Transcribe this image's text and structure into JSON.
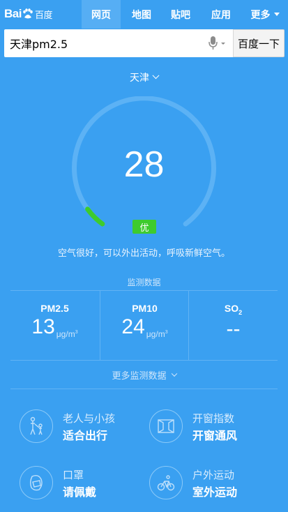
{
  "logo": {
    "text_a": "Bai",
    "text_b": "du",
    "text_cn": "百度"
  },
  "nav": {
    "tabs": [
      "网页",
      "地图",
      "贴吧",
      "应用"
    ],
    "more": "更多",
    "active_index": 0
  },
  "search": {
    "value": "天津pm2.5",
    "button": "百度一下"
  },
  "city": "天津",
  "aqi": {
    "value": "28",
    "level": "优",
    "tip": "空气很好，可以外出活动，呼吸新鲜空气。",
    "level_color": "#3ecb2e"
  },
  "monitor": {
    "title": "监测数据",
    "items": [
      {
        "name": "PM2.5",
        "value": "13",
        "unit": "μg/m",
        "unit_sup": "3"
      },
      {
        "name": "PM10",
        "value": "24",
        "unit": "μg/m",
        "unit_sup": "3"
      },
      {
        "name": "SO",
        "name_sub": "2",
        "value": "--"
      }
    ],
    "more": "更多监测数据"
  },
  "advice": [
    {
      "icon": "elderly-child-icon",
      "label": "老人与小孩",
      "value": "适合出行"
    },
    {
      "icon": "window-icon",
      "label": "开窗指数",
      "value": "开窗通风"
    },
    {
      "icon": "mask-icon",
      "label": "口罩",
      "value": "请佩戴"
    },
    {
      "icon": "cycling-icon",
      "label": "户外运动",
      "value": "室外运动"
    }
  ],
  "colors": {
    "background": "#3aa0f1",
    "active_tab": "#56aef4",
    "gauge_track": "#5cb2f5"
  }
}
